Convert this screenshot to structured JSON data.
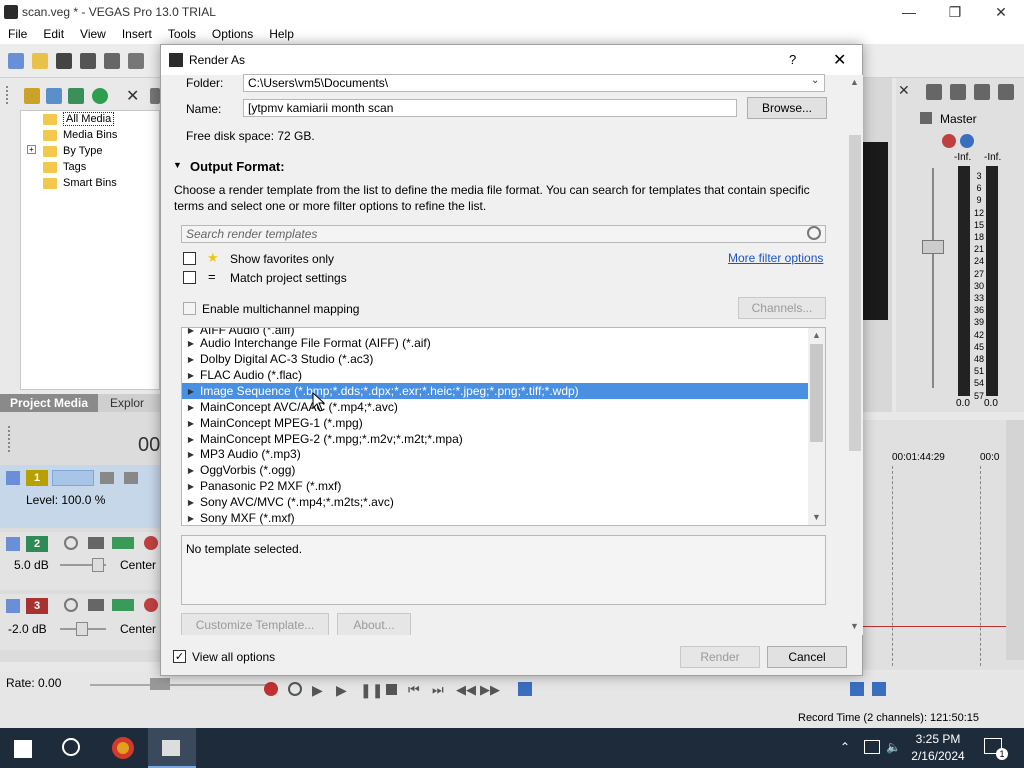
{
  "app": {
    "title": "scan.veg * - VEGAS Pro 13.0 TRIAL",
    "window_controls": [
      "minimize-icon",
      "restore-icon",
      "close-icon"
    ]
  },
  "menu": [
    "File",
    "Edit",
    "View",
    "Insert",
    "Tools",
    "Options",
    "Help"
  ],
  "explorer": {
    "tree": [
      {
        "label": "All Media",
        "selected": true
      },
      {
        "label": "Media Bins"
      },
      {
        "label": "By Type",
        "expandable": true
      },
      {
        "label": "Tags"
      },
      {
        "label": "Smart Bins"
      }
    ],
    "tabs": {
      "project_media": "Project Media",
      "explorer": "Explor"
    }
  },
  "time_display": "00",
  "tracks": [
    {
      "num": "1",
      "color": "#b8a000",
      "level_label": "Level: 100.0 %"
    },
    {
      "num": "2",
      "color": "#2e8b57",
      "db": "5.0 dB",
      "pan": "Center"
    },
    {
      "num": "3",
      "color": "#a83232",
      "db": "-2.0 dB",
      "pan": "Center"
    }
  ],
  "rate": "Rate: 0.00",
  "master": {
    "label": "Master",
    "inf_left": "-Inf.",
    "inf_right": "-Inf.",
    "scale": [
      "3",
      "6",
      "9",
      "12",
      "15",
      "18",
      "21",
      "24",
      "27",
      "30",
      "33",
      "36",
      "39",
      "42",
      "45",
      "48",
      "51",
      "54",
      "57"
    ],
    "bottom_left": "0.0",
    "bottom_right": "0.0"
  },
  "timeline": {
    "tc1": "00:01:44:29",
    "tc2": "00:0"
  },
  "status_record": "Record Time (2 channels): 121:50:15",
  "taskbar": {
    "time": "3:25 PM",
    "date": "2/16/2024",
    "notif_count": "1"
  },
  "dialog": {
    "title": "Render As",
    "help": "?",
    "folder_label": "Folder:",
    "folder_value": "C:\\Users\\vm5\\Documents\\",
    "name_label": "Name:",
    "name_value": "[ytpmv kamiarii month scan",
    "browse": "Browse...",
    "free_space": "Free disk space: 72 GB.",
    "output_format_heading": "Output Format:",
    "description": "Choose a render template from the list to define the media file format. You can search for templates that contain specific terms and select one or more filter options to refine the list.",
    "search_placeholder": "Search render templates",
    "show_favorites": "Show favorites only",
    "match_project": "Match project settings",
    "more_filter": "More filter options",
    "enable_multichannel": "Enable multichannel mapping",
    "channels": "Channels...",
    "templates": [
      {
        "label": "AIFF Audio (*.aiff)",
        "partial": true
      },
      {
        "label": "Audio Interchange File Format (AIFF) (*.aif)"
      },
      {
        "label": "Dolby Digital AC-3 Studio (*.ac3)"
      },
      {
        "label": "FLAC Audio (*.flac)"
      },
      {
        "label": "Image Sequence (*.bmp;*.dds;*.dpx;*.exr;*.heic;*.jpeg;*.png;*.tiff;*.wdp)",
        "selected": true
      },
      {
        "label": "MainConcept AVC/AAC (*.mp4;*.avc)"
      },
      {
        "label": "MainConcept MPEG-1 (*.mpg)"
      },
      {
        "label": "MainConcept MPEG-2 (*.mpg;*.m2v;*.m2t;*.mpa)"
      },
      {
        "label": "MP3 Audio (*.mp3)"
      },
      {
        "label": "OggVorbis (*.ogg)"
      },
      {
        "label": "Panasonic P2 MXF (*.mxf)"
      },
      {
        "label": "Sony AVC/MVC (*.mp4;*.m2ts;*.avc)"
      },
      {
        "label": "Sony MXF (*.mxf)"
      }
    ],
    "template_description": "No template selected.",
    "customize": "Customize Template...",
    "about": "About...",
    "view_all_options": "View all options",
    "view_all_checked": true,
    "render": "Render",
    "cancel": "Cancel"
  }
}
